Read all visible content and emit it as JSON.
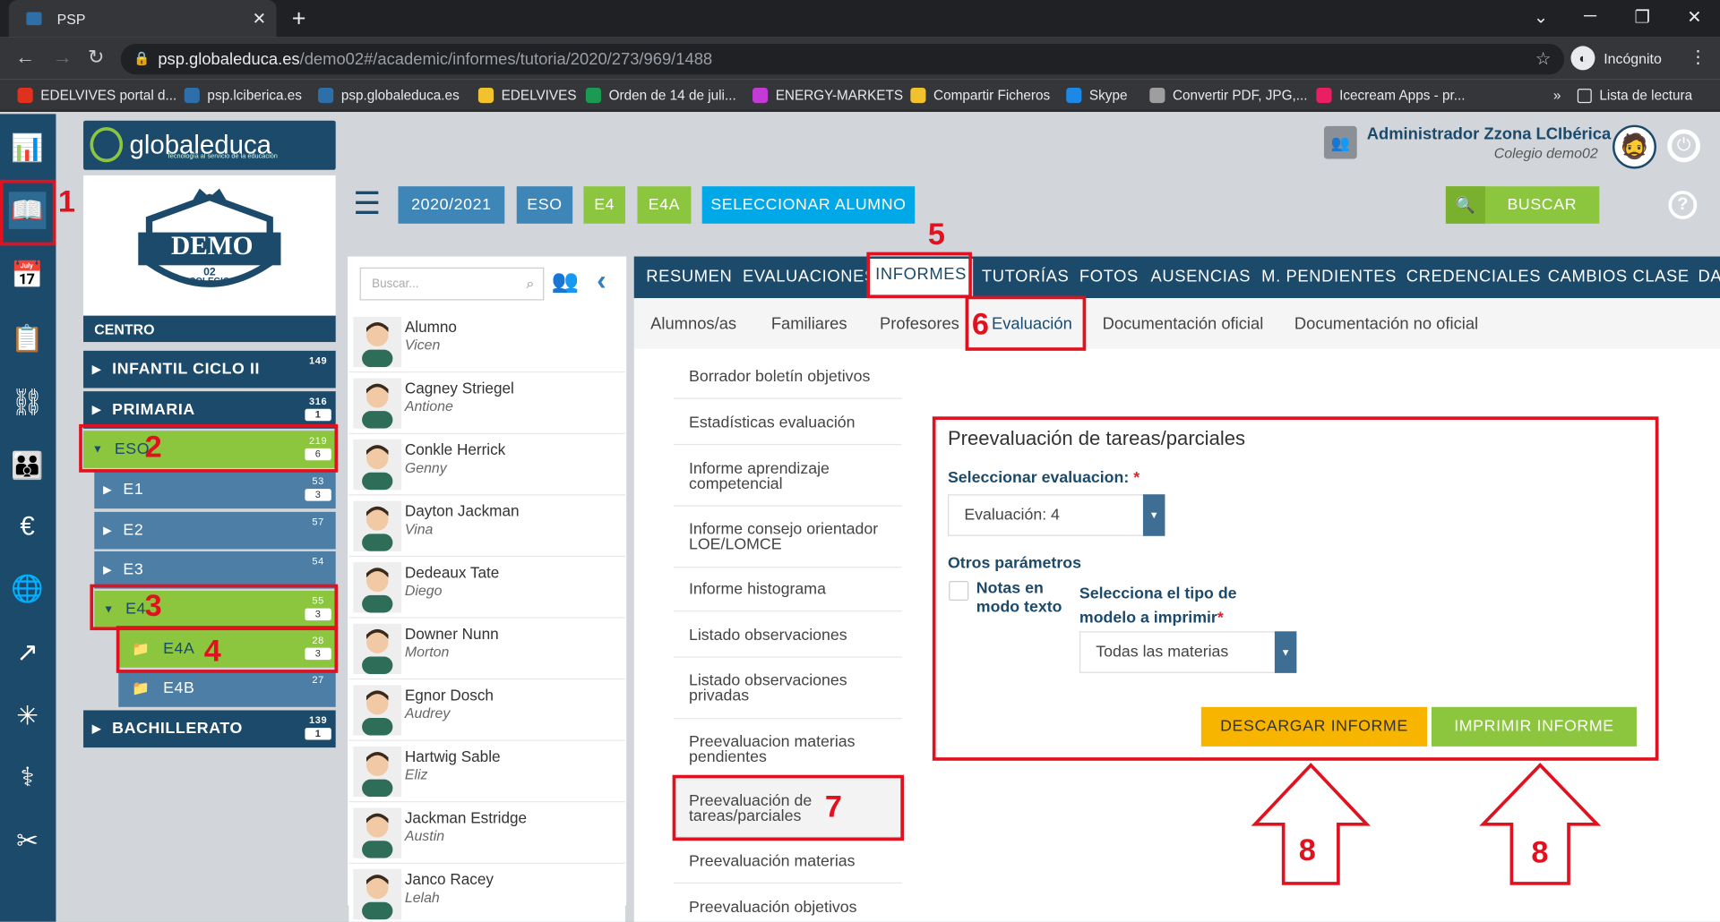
{
  "browser": {
    "tab_title": "PSP",
    "url_host": "psp.globaleduca.es",
    "url_path": "/demo02#/academic/informes/tutoria/2020/273/969/1488",
    "incognito_label": "Incógnito",
    "bookmarks": [
      {
        "label": "EDELVIVES portal d...",
        "color": "#e0301e"
      },
      {
        "label": "psp.lciberica.es",
        "color": "#2d6fa8"
      },
      {
        "label": "psp.globaleduca.es",
        "color": "#2d6fa8"
      },
      {
        "label": "EDELVIVES",
        "color": "#f2c12e"
      },
      {
        "label": "Orden de 14 de juli...",
        "color": "#1a9a52"
      },
      {
        "label": "ENERGY-MARKETS",
        "color": "#c23bd4"
      },
      {
        "label": "Compartir Ficheros",
        "color": "#f2c12e"
      },
      {
        "label": "Skype",
        "color": "#1e88e5"
      },
      {
        "label": "Convertir PDF, JPG,...",
        "color": "#9e9e9e"
      },
      {
        "label": "Icecream Apps - pr...",
        "color": "#e91e63"
      }
    ],
    "reading_list": "Lista de lectura",
    "more": "»"
  },
  "app": {
    "logo_text": "globaleduca",
    "logo_tagline": "Tecnología al servicio de la educación",
    "school_badge": {
      "name": "DEMO",
      "number": "02",
      "sub": "COLEGIO"
    },
    "centro_label": "CENTRO",
    "user_name": "Administrador Zzona LCIbérica",
    "user_school": "Colegio demo02"
  },
  "tree": {
    "infantil": {
      "label": "INFANTIL CICLO II",
      "count": "149"
    },
    "primaria": {
      "label": "PRIMARIA",
      "count": "316",
      "sub": "1"
    },
    "eso": {
      "label": "ESO",
      "count": "219",
      "sub": "6"
    },
    "e1": {
      "label": "E1",
      "count": "53",
      "sub": "3"
    },
    "e2": {
      "label": "E2",
      "count": "57"
    },
    "e3": {
      "label": "E3",
      "count": "54"
    },
    "e4": {
      "label": "E4",
      "count": "55",
      "sub": "3"
    },
    "e4a": {
      "label": "E4A",
      "count": "28",
      "sub": "3"
    },
    "e4b": {
      "label": "E4B",
      "count": "27"
    },
    "bach": {
      "label": "BACHILLERATO",
      "count": "139",
      "sub": "1"
    }
  },
  "toolbar": {
    "year": "2020/2021",
    "stage": "ESO",
    "course": "E4",
    "group": "E4A",
    "select_student": "SELECCIONAR ALUMNO",
    "search": "BUSCAR",
    "help": "?"
  },
  "students": {
    "search_placeholder": "Buscar...",
    "list": [
      {
        "name": "Alumno",
        "surname": "Vicen"
      },
      {
        "name": "Cagney Striegel",
        "surname": "Antione"
      },
      {
        "name": "Conkle Herrick",
        "surname": "Genny"
      },
      {
        "name": "Dayton Jackman",
        "surname": "Vina"
      },
      {
        "name": "Dedeaux Tate",
        "surname": "Diego"
      },
      {
        "name": "Downer Nunn",
        "surname": "Morton"
      },
      {
        "name": "Egnor Dosch",
        "surname": "Audrey"
      },
      {
        "name": "Hartwig Sable",
        "surname": "Eliz"
      },
      {
        "name": "Jackman Estridge",
        "surname": "Austin"
      },
      {
        "name": "Janco Racey",
        "surname": "Lelah"
      }
    ]
  },
  "main_tabs": [
    "RESUMEN",
    "EVALUACIONES",
    "INFORMES",
    "TUTORÍAS",
    "FOTOS",
    "AUSENCIAS",
    "M. PENDIENTES",
    "CREDENCIALES",
    "CAMBIOS CLASE",
    "DA"
  ],
  "sub_tabs": [
    "Alumnos/as",
    "Familiares",
    "Profesores",
    "Evaluación",
    "Documentación oficial",
    "Documentación no oficial"
  ],
  "reports": [
    "Borrador boletín objetivos",
    "Estadísticas evaluación",
    "Informe aprendizaje competencial",
    "Informe consejo orientador LOE/LOMCE",
    "Informe histograma",
    "Listado observaciones",
    "Listado observaciones privadas",
    "Preevaluacion materias pendientes",
    "Preevaluación de tareas/parciales",
    "Preevaluación materias",
    "Preevaluación objetivos"
  ],
  "form": {
    "title": "Preevaluación de tareas/parciales",
    "eval_label": "Seleccionar evaluacion:",
    "required_mark": "*",
    "eval_value": "Evaluación: 4",
    "other_params": "Otros parámetros",
    "notes_text_mode": "Notas en modo texto",
    "model_label": "Selecciona el tipo de modelo a imprimir",
    "model_value": "Todas las materias",
    "download_button": "DESCARGAR INFORME",
    "print_button": "IMPRIMIR INFORME"
  },
  "annotations": [
    "1",
    "2",
    "3",
    "4",
    "5",
    "6",
    "7",
    "8",
    "8"
  ],
  "colors": {
    "navy": "#1c4a6b",
    "green": "#8cc63f",
    "cyan": "#00a8e8",
    "steel": "#3e86b8",
    "yellow": "#f7b500",
    "red": "#e0121f"
  }
}
